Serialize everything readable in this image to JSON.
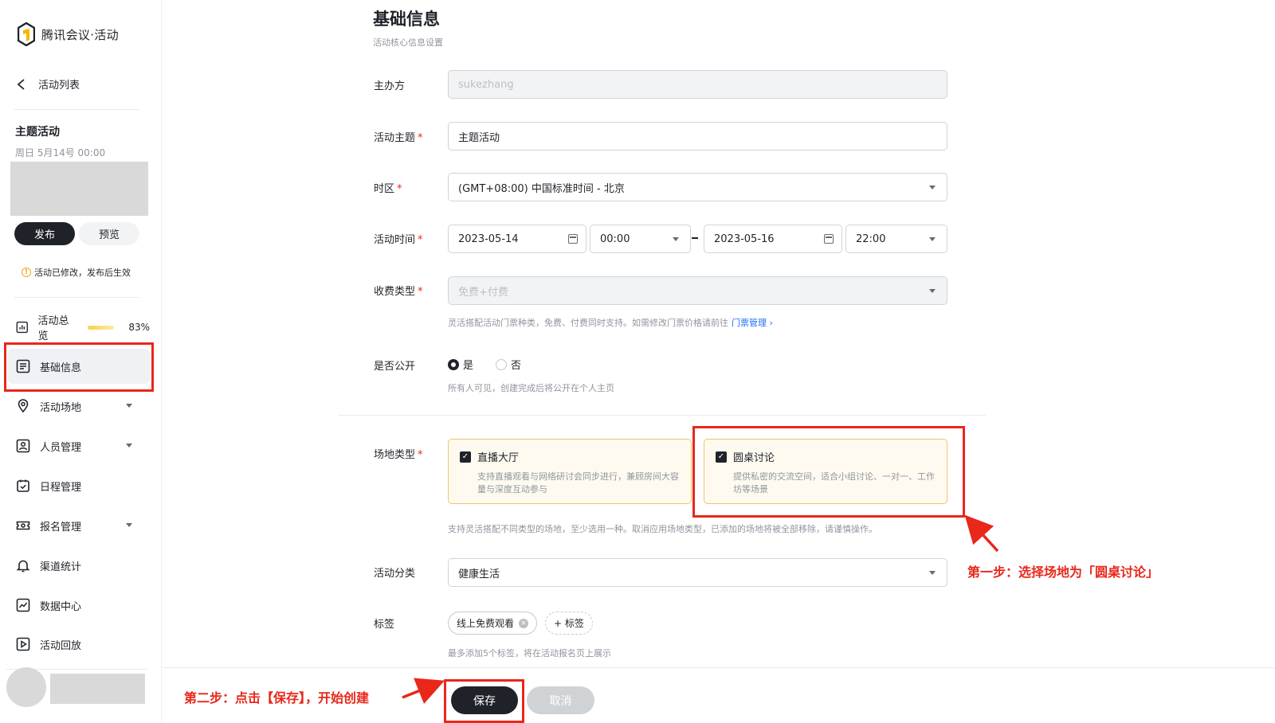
{
  "app": {
    "name": "腾讯会议·活动"
  },
  "sidebar": {
    "back_label": "活动列表",
    "activity_title": "主题活动",
    "activity_date": "周日 5月14号  00:00",
    "publish_label": "发布",
    "preview_label": "预览",
    "notice": "活动已修改，发布后生效",
    "overview": {
      "label": "活动总览",
      "progress": 83,
      "progress_text": "83%"
    },
    "items": [
      {
        "label": "基础信息"
      },
      {
        "label": "活动场地"
      },
      {
        "label": "人员管理"
      },
      {
        "label": "日程管理"
      },
      {
        "label": "报名管理"
      },
      {
        "label": "渠道统计"
      },
      {
        "label": "数据中心"
      },
      {
        "label": "活动回放"
      }
    ]
  },
  "main": {
    "title": "基础信息",
    "subtitle": "活动核心信息设置",
    "organizer": {
      "label": "主办方",
      "value": "sukezhang"
    },
    "theme": {
      "label": "活动主题",
      "value": "主题活动"
    },
    "timezone": {
      "label": "时区",
      "value": "(GMT+08:00) 中国标准时间 - 北京"
    },
    "time": {
      "label": "活动时间",
      "start_date": "2023-05-14",
      "start_time": "00:00",
      "end_date": "2023-05-16",
      "end_time": "22:00"
    },
    "fee": {
      "label": "收费类型",
      "value": "免费+付费",
      "hint": "灵活搭配活动门票种类，免费、付费同时支持。如需修改门票价格请前往",
      "link": "门票管理 ›"
    },
    "public": {
      "label": "是否公开",
      "yes": "是",
      "no": "否",
      "hint": "所有人可见，创建完成后将公开在个人主页"
    },
    "venue": {
      "label": "场地类型",
      "options": [
        {
          "title": "直播大厅",
          "desc": "支持直播观看与网络研讨会同步进行，兼顾房间大容量与深度互动参与"
        },
        {
          "title": "圆桌讨论",
          "desc": "提供私密的交流空间，适合小组讨论、一对一、工作坊等场景"
        }
      ],
      "hint": "支持灵活搭配不同类型的场地，至少选用一种。取消应用场地类型，已添加的场地将被全部移除，请谨慎操作。"
    },
    "category": {
      "label": "活动分类",
      "value": "健康生活"
    },
    "tags": {
      "label": "标签",
      "items": [
        "线上免费观看"
      ],
      "add_label": "+ 标签",
      "hint": "最多添加5个标签，将在活动报名页上展示"
    },
    "save_label": "保存",
    "cancel_label": "取消"
  },
  "annotations": {
    "step1": "第一步：选择场地为「圆桌讨论」",
    "step2": "第二步：点击【保存】，开始创建"
  },
  "colors": {
    "accent": "#1f2329",
    "annotation": "#e9271b",
    "link": "#1e6ef5",
    "venue_border": "#f0c36d"
  }
}
